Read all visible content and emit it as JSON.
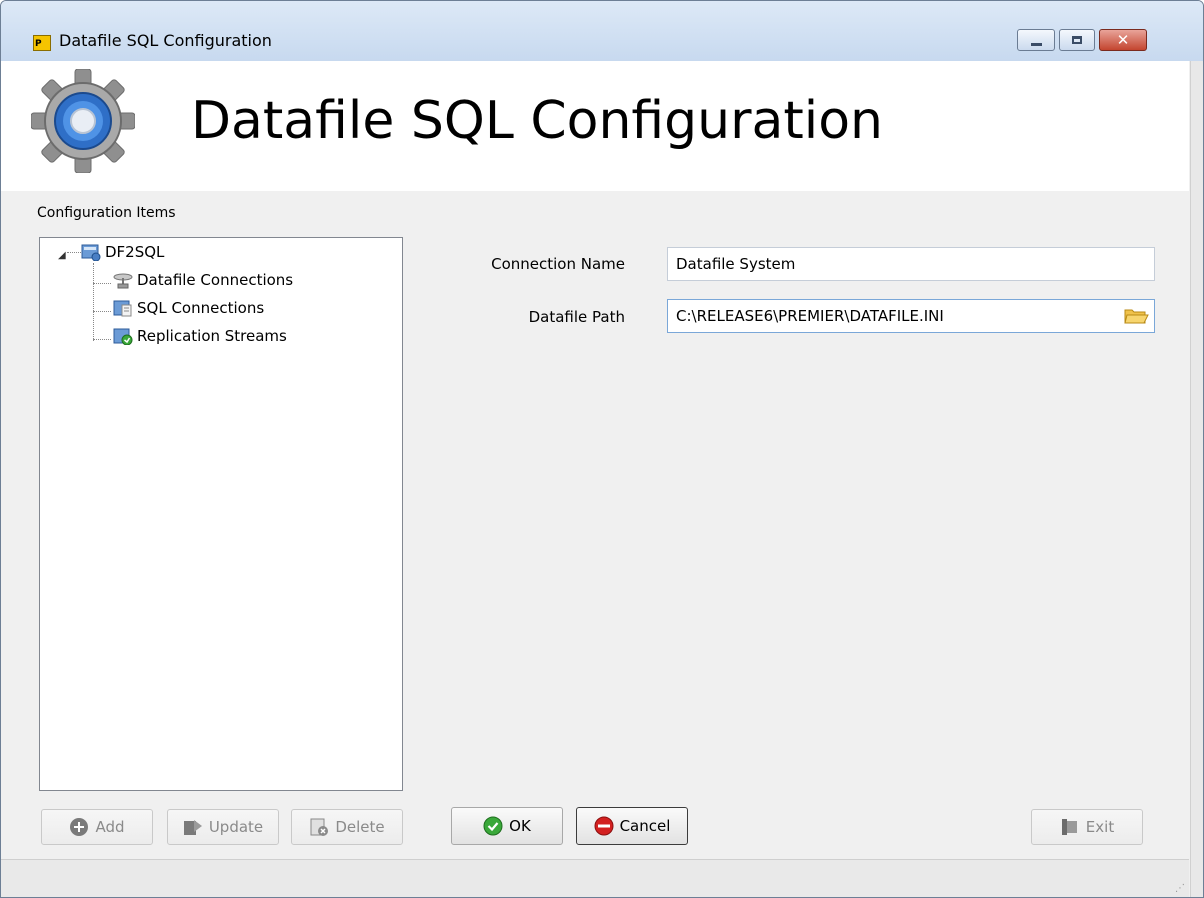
{
  "window": {
    "title": "Datafile SQL Configuration",
    "icon_text": "P",
    "icons": {
      "app": "app-icon",
      "minimize": "minimize-icon",
      "maximize": "maximize-icon",
      "close": "close-icon"
    },
    "close_glyph": "✕"
  },
  "header": {
    "title": "Datafile SQL Configuration",
    "icon": "gear-icon"
  },
  "sidebar": {
    "label": "Configuration Items",
    "tree": {
      "expand_glyph": "◢",
      "root": {
        "label": "DF2SQL",
        "icon": "server-icon"
      },
      "children": [
        {
          "label": "Datafile Connections",
          "icon": "satellite-icon"
        },
        {
          "label": "SQL Connections",
          "icon": "database-icon"
        },
        {
          "label": "Replication Streams",
          "icon": "stream-icon"
        }
      ]
    },
    "buttons": {
      "add": "Add",
      "update": "Update",
      "delete": "Delete"
    }
  },
  "form": {
    "connection_name_label": "Connection Name",
    "connection_name_value": "Datafile System",
    "datafile_path_label": "Datafile Path",
    "datafile_path_value": "C:\\RELEASE6\\PREMIER\\DATAFILE.INI",
    "folder_icon": "folder-icon"
  },
  "actions": {
    "ok": "OK",
    "cancel": "Cancel",
    "exit": "Exit"
  },
  "statusbar": {
    "grip": "⋰"
  },
  "colors": {
    "title_bar": "#c7d9ef",
    "close_button": "#c3452f",
    "ok_green": "#3aa83a",
    "cancel_red": "#d32020",
    "gear_blue": "#2f6fc7"
  }
}
